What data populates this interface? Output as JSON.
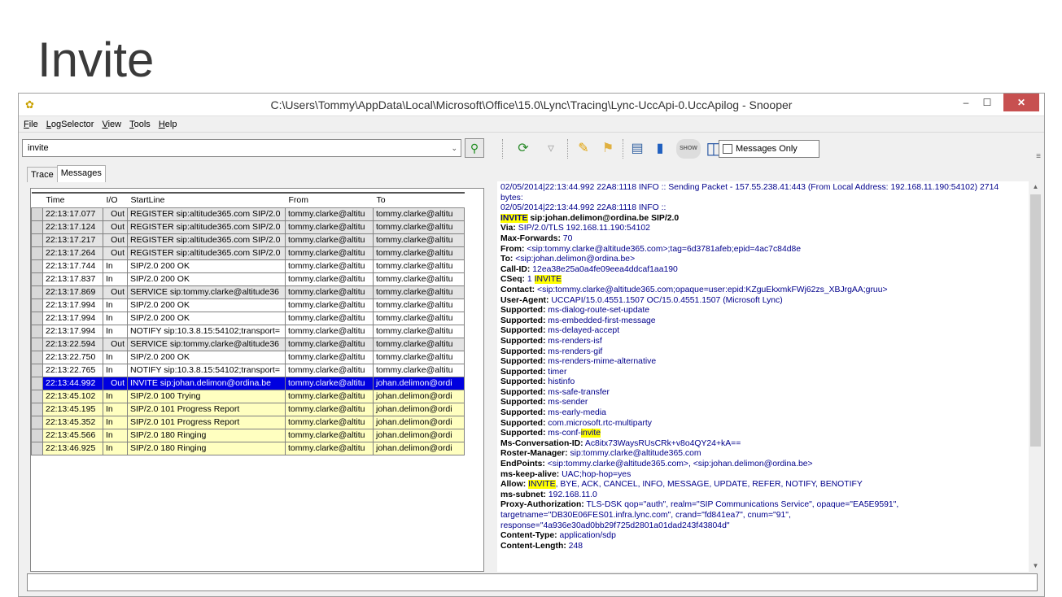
{
  "slide": {
    "title": "Invite"
  },
  "window": {
    "title": "C:\\Users\\Tommy\\AppData\\Local\\Microsoft\\Office\\15.0\\Lync\\Tracing\\Lync-UccApi-0.UccApilog - Snooper",
    "min_glyph": "–",
    "max_glyph": "☐",
    "close_glyph": "✕"
  },
  "menu": [
    {
      "label": "File",
      "accel": "F",
      "rest": "ile"
    },
    {
      "label": "LogSelector",
      "accel": "L",
      "rest": "ogSelector"
    },
    {
      "label": "View",
      "accel": "V",
      "rest": "iew"
    },
    {
      "label": "Tools",
      "accel": "T",
      "rest": "ools"
    },
    {
      "label": "Help",
      "accel": "H",
      "rest": "elp"
    }
  ],
  "search": {
    "value": "invite",
    "arrow": "⌄",
    "button_icon": "magnifier-icon"
  },
  "toolbar": {
    "messages_only_label": "Messages Only",
    "messages_only_checked": false
  },
  "tabs": [
    {
      "label": "Trace",
      "active": false
    },
    {
      "label": "Messages",
      "active": true
    }
  ],
  "grid": {
    "columns": [
      "Time",
      "I/O",
      "StartLine",
      "From",
      "To"
    ],
    "rows": [
      {
        "time": "22:13:17.077",
        "io": "Out",
        "start": "REGISTER sip:altitude365.com SIP/2.0",
        "from": "tommy.clarke@altitu",
        "to": "tommy.clarke@altitu",
        "style": "gray"
      },
      {
        "time": "22:13:17.124",
        "io": "Out",
        "start": "REGISTER sip:altitude365.com SIP/2.0",
        "from": "tommy.clarke@altitu",
        "to": "tommy.clarke@altitu",
        "style": "gray"
      },
      {
        "time": "22:13:17.217",
        "io": "Out",
        "start": "REGISTER sip:altitude365.com SIP/2.0",
        "from": "tommy.clarke@altitu",
        "to": "tommy.clarke@altitu",
        "style": "gray"
      },
      {
        "time": "22:13:17.264",
        "io": "Out",
        "start": "REGISTER sip:altitude365.com SIP/2.0",
        "from": "tommy.clarke@altitu",
        "to": "tommy.clarke@altitu",
        "style": "gray"
      },
      {
        "time": "22:13:17.744",
        "io": "In",
        "start": "SIP/2.0 200 OK",
        "from": "tommy.clarke@altitu",
        "to": "tommy.clarke@altitu",
        "style": "white"
      },
      {
        "time": "22:13:17.837",
        "io": "In",
        "start": "SIP/2.0 200 OK",
        "from": "tommy.clarke@altitu",
        "to": "tommy.clarke@altitu",
        "style": "white"
      },
      {
        "time": "22:13:17.869",
        "io": "Out",
        "start": "SERVICE sip:tommy.clarke@altitude36",
        "from": "tommy.clarke@altitu",
        "to": "tommy.clarke@altitu",
        "style": "gray"
      },
      {
        "time": "22:13:17.994",
        "io": "In",
        "start": "SIP/2.0 200 OK",
        "from": "tommy.clarke@altitu",
        "to": "tommy.clarke@altitu",
        "style": "white"
      },
      {
        "time": "22:13:17.994",
        "io": "In",
        "start": "SIP/2.0 200 OK",
        "from": "tommy.clarke@altitu",
        "to": "tommy.clarke@altitu",
        "style": "white"
      },
      {
        "time": "22:13:17.994",
        "io": "In",
        "start": "NOTIFY sip:10.3.8.15:54102;transport=",
        "from": "tommy.clarke@altitu",
        "to": "tommy.clarke@altitu",
        "style": "white"
      },
      {
        "time": "22:13:22.594",
        "io": "Out",
        "start": "SERVICE sip:tommy.clarke@altitude36",
        "from": "tommy.clarke@altitu",
        "to": "tommy.clarke@altitu",
        "style": "gray"
      },
      {
        "time": "22:13:22.750",
        "io": "In",
        "start": "SIP/2.0 200 OK",
        "from": "tommy.clarke@altitu",
        "to": "tommy.clarke@altitu",
        "style": "white"
      },
      {
        "time": "22:13:22.765",
        "io": "In",
        "start": "NOTIFY sip:10.3.8.15:54102;transport=",
        "from": "tommy.clarke@altitu",
        "to": "tommy.clarke@altitu",
        "style": "white"
      },
      {
        "time": "22:13:44.992",
        "io": "Out",
        "start": "INVITE sip:johan.delimon@ordina.be",
        "from": "tommy.clarke@altitu",
        "to": "johan.delimon@ordi",
        "style": "blue"
      },
      {
        "time": "22:13:45.102",
        "io": "In",
        "start": "SIP/2.0 100 Trying",
        "from": "tommy.clarke@altitu",
        "to": "johan.delimon@ordi",
        "style": "yellow"
      },
      {
        "time": "22:13:45.195",
        "io": "In",
        "start": "SIP/2.0 101 Progress Report",
        "from": "tommy.clarke@altitu",
        "to": "johan.delimon@ordi",
        "style": "yellow"
      },
      {
        "time": "22:13:45.352",
        "io": "In",
        "start": "SIP/2.0 101 Progress Report",
        "from": "tommy.clarke@altitu",
        "to": "johan.delimon@ordi",
        "style": "yellow"
      },
      {
        "time": "22:13:45.566",
        "io": "In",
        "start": "SIP/2.0 180 Ringing",
        "from": "tommy.clarke@altitu",
        "to": "johan.delimon@ordi",
        "style": "yellow"
      },
      {
        "time": "22:13:46.925",
        "io": "In",
        "start": "SIP/2.0 180 Ringing",
        "from": "tommy.clarke@altitu",
        "to": "johan.delimon@ordi",
        "style": "yellow"
      }
    ]
  },
  "detail": {
    "lines": [
      [
        {
          "t": "02/05/2014|22:13:44.992 22A8:1118 INFO  :: Sending Packet - 157.55.238.41:443 (From Local Address: 192.168.11.190:54102) 2714"
        }
      ],
      [
        {
          "t": "bytes:"
        }
      ],
      [
        {
          "t": "02/05/2014|22:13:44.992 22A8:1118 INFO  ::"
        }
      ],
      [
        {
          "t": "INVITE",
          "b": 1,
          "h": 1
        },
        {
          "t": " sip:johan.delimon@ordina.be SIP/2.0",
          "b": 1
        }
      ],
      [
        {
          "t": "Via:",
          "b": 1
        },
        {
          "t": " SIP/2.0/TLS 192.168.11.190:54102"
        }
      ],
      [
        {
          "t": "Max-Forwards:",
          "b": 1
        },
        {
          "t": " 70"
        }
      ],
      [
        {
          "t": "From:",
          "b": 1
        },
        {
          "t": " <sip:tommy.clarke@altitude365.com>;tag=6d3781afeb;epid=4ac7c84d8e"
        }
      ],
      [
        {
          "t": "To:",
          "b": 1
        },
        {
          "t": " <sip:johan.delimon@ordina.be>"
        }
      ],
      [
        {
          "t": "Call-ID:",
          "b": 1
        },
        {
          "t": " 12ea38e25a0a4fe09eea4ddcaf1aa190"
        }
      ],
      [
        {
          "t": "CSeq:",
          "b": 1
        },
        {
          "t": " 1 "
        },
        {
          "t": "INVITE",
          "h": 1
        }
      ],
      [
        {
          "t": "Contact:",
          "b": 1
        },
        {
          "t": " <sip:tommy.clarke@altitude365.com;opaque=user:epid:KZguEkxmkFWj62zs_XBJrgAA;gruu>"
        }
      ],
      [
        {
          "t": "User-Agent:",
          "b": 1
        },
        {
          "t": " UCCAPI/15.0.4551.1507 OC/15.0.4551.1507 (Microsoft Lync)"
        }
      ],
      [
        {
          "t": "Supported:",
          "b": 1
        },
        {
          "t": " ms-dialog-route-set-update"
        }
      ],
      [
        {
          "t": "Supported:",
          "b": 1
        },
        {
          "t": " ms-embedded-first-message"
        }
      ],
      [
        {
          "t": "Supported:",
          "b": 1
        },
        {
          "t": " ms-delayed-accept"
        }
      ],
      [
        {
          "t": "Supported:",
          "b": 1
        },
        {
          "t": " ms-renders-isf"
        }
      ],
      [
        {
          "t": "Supported:",
          "b": 1
        },
        {
          "t": " ms-renders-gif"
        }
      ],
      [
        {
          "t": "Supported:",
          "b": 1
        },
        {
          "t": " ms-renders-mime-alternative"
        }
      ],
      [
        {
          "t": "Supported:",
          "b": 1
        },
        {
          "t": " timer"
        }
      ],
      [
        {
          "t": "Supported:",
          "b": 1
        },
        {
          "t": " histinfo"
        }
      ],
      [
        {
          "t": "Supported:",
          "b": 1
        },
        {
          "t": " ms-safe-transfer"
        }
      ],
      [
        {
          "t": "Supported:",
          "b": 1
        },
        {
          "t": " ms-sender"
        }
      ],
      [
        {
          "t": "Supported:",
          "b": 1
        },
        {
          "t": " ms-early-media"
        }
      ],
      [
        {
          "t": "Supported:",
          "b": 1
        },
        {
          "t": " com.microsoft.rtc-multiparty"
        }
      ],
      [
        {
          "t": "Supported:",
          "b": 1
        },
        {
          "t": " ms-conf-"
        },
        {
          "t": "invite",
          "h": 1
        }
      ],
      [
        {
          "t": "Ms-Conversation-ID:",
          "b": 1
        },
        {
          "t": " Ac8itx73WaysRUsCRk+v8o4QY24+kA=="
        }
      ],
      [
        {
          "t": "Roster-Manager:",
          "b": 1
        },
        {
          "t": " sip:tommy.clarke@altitude365.com"
        }
      ],
      [
        {
          "t": "EndPoints:",
          "b": 1
        },
        {
          "t": " <sip:tommy.clarke@altitude365.com>, <sip:johan.delimon@ordina.be>"
        }
      ],
      [
        {
          "t": "ms-keep-alive:",
          "b": 1
        },
        {
          "t": " UAC;hop-hop=yes"
        }
      ],
      [
        {
          "t": "Allow:",
          "b": 1
        },
        {
          "t": " "
        },
        {
          "t": "INVITE",
          "h": 1
        },
        {
          "t": ", BYE, ACK, CANCEL, INFO, MESSAGE, UPDATE, REFER, NOTIFY, BENOTIFY"
        }
      ],
      [
        {
          "t": "ms-subnet:",
          "b": 1
        },
        {
          "t": " 192.168.11.0"
        }
      ],
      [
        {
          "t": "Proxy-Authorization:",
          "b": 1
        },
        {
          "t": " TLS-DSK qop=\"auth\", realm=\"SIP Communications Service\", opaque=\"EA5E9591\","
        }
      ],
      [
        {
          "t": "targetname=\"DB30E06FES01.infra.lync.com\", crand=\"fd841ea7\", cnum=\"91\","
        }
      ],
      [
        {
          "t": "response=\"4a936e30ad0bb29f725d2801a01dad243f43804d\""
        }
      ],
      [
        {
          "t": "Content-Type:",
          "b": 1
        },
        {
          "t": " application/sdp"
        }
      ],
      [
        {
          "t": "Content-Length:",
          "b": 1
        },
        {
          "t": " 248"
        }
      ]
    ]
  },
  "colors": {
    "selected_row": "#0000e0",
    "response_row": "#ffffc0",
    "request_row": "#e4e4e4",
    "highlight": "#ffff00",
    "close_button": "#c75050"
  }
}
